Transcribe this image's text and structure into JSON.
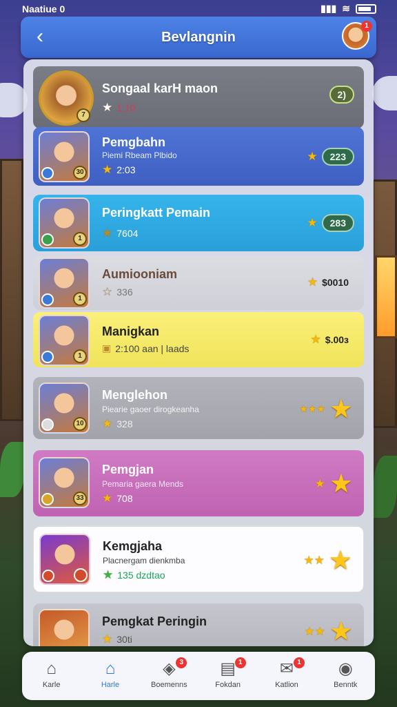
{
  "status_bar": {
    "left": "Naatiue 0",
    "right_icons": [
      "signal-icon",
      "wifi-icon",
      "battery-icon"
    ]
  },
  "header": {
    "title": "Bevlangnin",
    "back_icon": "back-arrow-icon",
    "avatar_badge": "1"
  },
  "players": [
    {
      "name": "Songaal karH maon",
      "sub": "",
      "meta": "1:10",
      "score": "2)",
      "score_style": "pill-only",
      "rank": "7",
      "theme": "gray"
    },
    {
      "name": "Pemgbahn",
      "sub": "Piemi Rbeam Plbido",
      "meta": "2:03",
      "score": "223",
      "score_style": "pill",
      "rank": "30",
      "theme": "blue"
    },
    {
      "name": "Peringkatt Pemain",
      "sub": "",
      "meta": "7604",
      "score": "283",
      "score_style": "pill",
      "rank": "1",
      "theme": "cyan"
    },
    {
      "name": "Aumiooniam",
      "sub": "",
      "meta": "336",
      "score": "$0010",
      "score_style": "plain",
      "rank": "1",
      "theme": "light"
    },
    {
      "name": "Manigkan",
      "sub": "",
      "meta": "2:100 aan | laads",
      "score": "$.00ɜ",
      "score_style": "plain",
      "rank": "1",
      "theme": "yellow"
    },
    {
      "name": "Menglehon",
      "sub": "Piearie gaoer dirogkeanha",
      "meta": "328",
      "score": "",
      "score_style": "stars",
      "rank": "10",
      "theme": "gray2"
    },
    {
      "name": "Pemgjan",
      "sub": "Pemaria gaera Mends",
      "meta": "708",
      "score": "",
      "score_style": "stars",
      "rank": "33",
      "theme": "pink"
    },
    {
      "name": "Kemgjaha",
      "sub": "Placnergam dienkmba",
      "meta": "135 dzdtao",
      "score": "",
      "score_style": "stars",
      "rank": "",
      "theme": "white"
    },
    {
      "name": "Pemgkat Peringin",
      "sub": "",
      "meta": "30ti",
      "score": "",
      "score_style": "stars",
      "rank": "",
      "theme": "gray3"
    }
  ],
  "nav": [
    {
      "label": "Karle",
      "icon": "home-icon",
      "badge": ""
    },
    {
      "label": "Harle",
      "icon": "home-active-icon",
      "badge": "",
      "active": true
    },
    {
      "label": "Boemenns",
      "icon": "cube-icon",
      "badge": "3"
    },
    {
      "label": "Fokdan",
      "icon": "clipboard-icon",
      "badge": "1"
    },
    {
      "label": "Katlion",
      "icon": "chat-icon",
      "badge": "1"
    },
    {
      "label": "Benntk",
      "icon": "profile-icon",
      "badge": ""
    }
  ]
}
